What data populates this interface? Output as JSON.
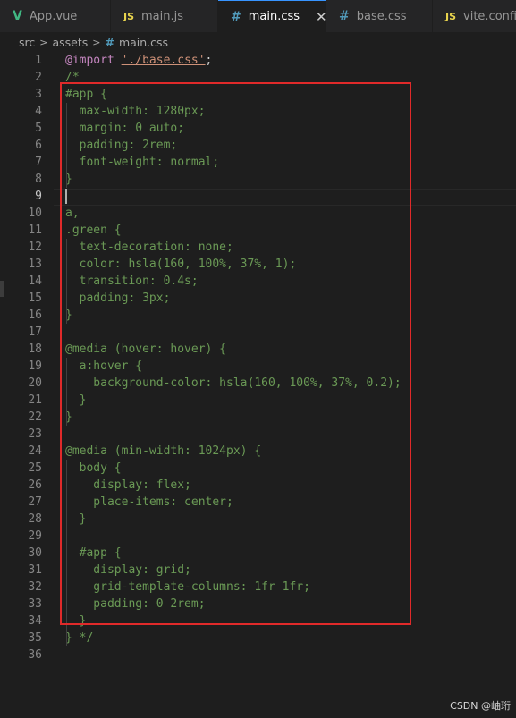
{
  "tabs": [
    {
      "label": "App.vue",
      "icon": "vue-icon",
      "active": false
    },
    {
      "label": "main.js",
      "icon": "js-icon",
      "active": false
    },
    {
      "label": "main.css",
      "icon": "css-icon",
      "active": true
    },
    {
      "label": "base.css",
      "icon": "css-icon",
      "active": false
    },
    {
      "label": "vite.config",
      "icon": "js-icon",
      "active": false
    }
  ],
  "icons": {
    "js_text": "JS",
    "css_text": "#",
    "vue_text": "V",
    "close": "✕"
  },
  "breadcrumb": {
    "parts": [
      "src",
      "assets",
      "main.css"
    ]
  },
  "colors": {
    "accent": "#3794ff",
    "highlight_box": "#e02a2a",
    "comment": "#6a9955"
  },
  "editor": {
    "current_line": 9,
    "lines": [
      {
        "n": "1",
        "segs": [
          {
            "t": "@import",
            "c": "at"
          },
          {
            "t": " ",
            "c": "punc"
          },
          {
            "t": "'./base.css'",
            "c": "str"
          },
          {
            "t": ";",
            "c": "punc"
          }
        ]
      },
      {
        "n": "2",
        "segs": [
          {
            "t": "/*",
            "c": ""
          }
        ]
      },
      {
        "n": "3",
        "segs": [
          {
            "t": "#app {",
            "c": ""
          }
        ]
      },
      {
        "n": "4",
        "segs": [
          {
            "t": "  max-width: 1280px;",
            "c": ""
          }
        ]
      },
      {
        "n": "5",
        "segs": [
          {
            "t": "  margin: 0 auto;",
            "c": ""
          }
        ]
      },
      {
        "n": "6",
        "segs": [
          {
            "t": "  padding: 2rem;",
            "c": ""
          }
        ]
      },
      {
        "n": "7",
        "segs": [
          {
            "t": "  font-weight: normal;",
            "c": ""
          }
        ]
      },
      {
        "n": "8",
        "segs": [
          {
            "t": "}",
            "c": ""
          }
        ]
      },
      {
        "n": "9",
        "segs": [
          {
            "t": "",
            "c": ""
          }
        ]
      },
      {
        "n": "10",
        "segs": [
          {
            "t": "a,",
            "c": ""
          }
        ]
      },
      {
        "n": "11",
        "segs": [
          {
            "t": ".green {",
            "c": ""
          }
        ]
      },
      {
        "n": "12",
        "segs": [
          {
            "t": "  text-decoration: none;",
            "c": ""
          }
        ]
      },
      {
        "n": "13",
        "segs": [
          {
            "t": "  color: hsla(160, 100%, 37%, 1);",
            "c": ""
          }
        ]
      },
      {
        "n": "14",
        "segs": [
          {
            "t": "  transition: 0.4s;",
            "c": ""
          }
        ]
      },
      {
        "n": "15",
        "segs": [
          {
            "t": "  padding: 3px;",
            "c": ""
          }
        ]
      },
      {
        "n": "16",
        "segs": [
          {
            "t": "}",
            "c": ""
          }
        ]
      },
      {
        "n": "17",
        "segs": [
          {
            "t": "",
            "c": ""
          }
        ]
      },
      {
        "n": "18",
        "segs": [
          {
            "t": "@media (hover: hover) {",
            "c": ""
          }
        ]
      },
      {
        "n": "19",
        "segs": [
          {
            "t": "  a:hover {",
            "c": ""
          }
        ]
      },
      {
        "n": "20",
        "segs": [
          {
            "t": "    background-color: hsla(160, 100%, 37%, 0.2);",
            "c": ""
          }
        ]
      },
      {
        "n": "21",
        "segs": [
          {
            "t": "  }",
            "c": ""
          }
        ]
      },
      {
        "n": "22",
        "segs": [
          {
            "t": "}",
            "c": ""
          }
        ]
      },
      {
        "n": "23",
        "segs": [
          {
            "t": "",
            "c": ""
          }
        ]
      },
      {
        "n": "24",
        "segs": [
          {
            "t": "@media (min-width: 1024px) {",
            "c": ""
          }
        ]
      },
      {
        "n": "25",
        "segs": [
          {
            "t": "  body {",
            "c": ""
          }
        ]
      },
      {
        "n": "26",
        "segs": [
          {
            "t": "    display: flex;",
            "c": ""
          }
        ]
      },
      {
        "n": "27",
        "segs": [
          {
            "t": "    place-items: center;",
            "c": ""
          }
        ]
      },
      {
        "n": "28",
        "segs": [
          {
            "t": "  }",
            "c": ""
          }
        ]
      },
      {
        "n": "29",
        "segs": [
          {
            "t": "",
            "c": ""
          }
        ]
      },
      {
        "n": "30",
        "segs": [
          {
            "t": "  #app {",
            "c": ""
          }
        ]
      },
      {
        "n": "31",
        "segs": [
          {
            "t": "    display: grid;",
            "c": ""
          }
        ]
      },
      {
        "n": "32",
        "segs": [
          {
            "t": "    grid-template-columns: 1fr 1fr;",
            "c": ""
          }
        ]
      },
      {
        "n": "33",
        "segs": [
          {
            "t": "    padding: 0 2rem;",
            "c": ""
          }
        ]
      },
      {
        "n": "34",
        "segs": [
          {
            "t": "  }",
            "c": ""
          }
        ]
      },
      {
        "n": "35",
        "segs": [
          {
            "t": "} */",
            "c": ""
          }
        ]
      },
      {
        "n": "36",
        "segs": [
          {
            "t": "",
            "c": ""
          }
        ]
      }
    ]
  },
  "watermark": "CSDN @岫珩"
}
